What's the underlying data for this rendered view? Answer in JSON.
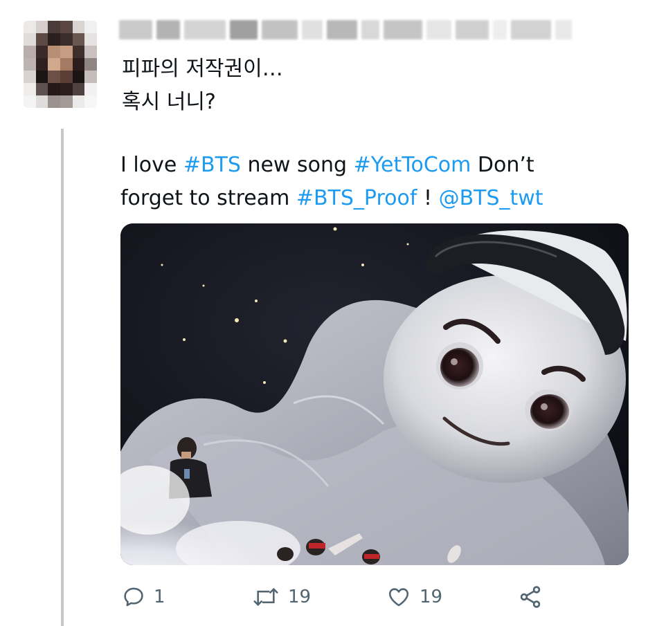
{
  "reply": {
    "line1": "피파의 저작권이…",
    "line2": "혹시 너니?"
  },
  "quoted_tweet": {
    "segments": [
      {
        "text": "I love ",
        "highlight": false
      },
      {
        "text": "#BTS",
        "highlight": true
      },
      {
        "text": " new song ",
        "highlight": false
      },
      {
        "text": "#YetToCom",
        "highlight": true
      },
      {
        "text": "  Don’t ",
        "highlight": false
      },
      {
        "text": "forget to stream ",
        "highlight": false
      },
      {
        "text": "#BTS_Proof",
        "highlight": true
      },
      {
        "text": " ! ",
        "highlight": false
      },
      {
        "text": "@BTS_twt",
        "highlight": true
      }
    ]
  },
  "actions": {
    "reply_count": "1",
    "retweet_count": "19",
    "like_count": "19"
  },
  "icons": {
    "reply": "reply-icon",
    "retweet": "retweet-icon",
    "like": "heart-icon",
    "share": "share-icon"
  },
  "colors": {
    "link": "#1d9bf0",
    "text": "#0f1419",
    "muted": "#536471"
  }
}
